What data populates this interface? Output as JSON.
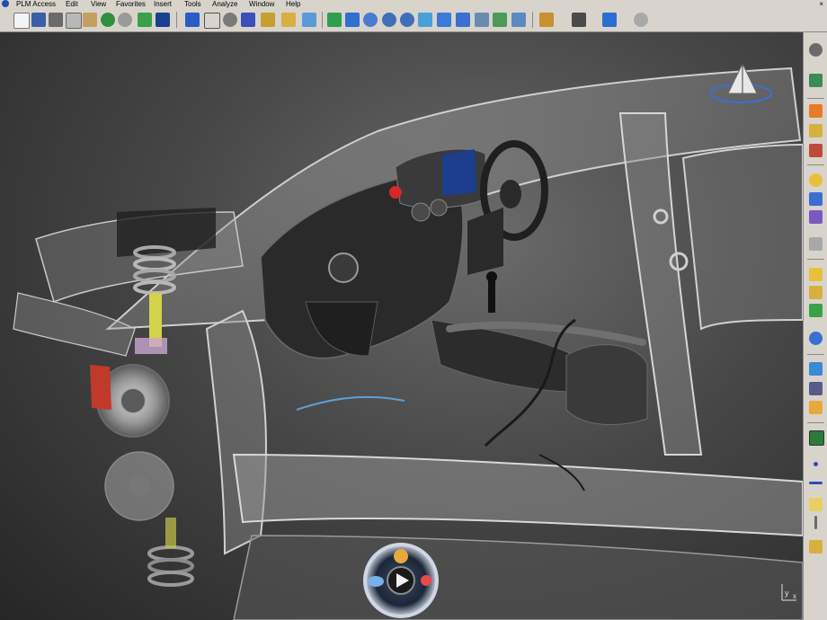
{
  "menubar": {
    "items": [
      "PLM Access",
      "Edit",
      "View",
      "Favorites",
      "Insert",
      "Tools",
      "Analyze",
      "Window",
      "Help"
    ],
    "close_glyph": "×"
  },
  "toolbar": {
    "icons": [
      "new-file-icon",
      "save-icon",
      "print-icon",
      "cut-icon",
      "copy-icon",
      "paste-icon",
      "undo-icon",
      "redo-icon",
      "update-icon",
      "whats-this-icon",
      "select-arrow-icon",
      "formula-icon",
      "catalog-icon",
      "table-icon",
      "sketch-icon",
      "body-icon",
      "hole-icon",
      "fit-all-icon",
      "pan-icon",
      "rotate-icon",
      "zoom-in-icon",
      "zoom-out-icon",
      "normal-view-icon",
      "multi-view-icon",
      "iso-view-icon",
      "shading-icon",
      "render-icon",
      "hide-show-icon",
      "capture-icon",
      "video-icon",
      "swap-icon",
      "undo-history-icon"
    ]
  },
  "right_toolbar": {
    "icons": [
      "sketcher-icon",
      "constraint-icon",
      "pointer-icon",
      "part-body-icon",
      "tree-icon",
      "material-icon",
      "measure-icon",
      "analysis-icon",
      "filter-icon",
      "assembly-icon",
      "product-icon",
      "component-icon",
      "move-icon",
      "snap-icon",
      "clash-icon",
      "explode-icon",
      "plane-icon",
      "point-icon",
      "line-icon",
      "surface-icon",
      "axis-icon",
      "law-icon"
    ]
  },
  "viewport": {
    "axis_labels": {
      "x": "x",
      "y": "y"
    },
    "compass": "compass-icon",
    "navigator": [
      "collaboration-icon",
      "play-icon",
      "network-icon",
      "cloud-icon"
    ]
  },
  "colors": {
    "ui_gray": "#d8d4cc",
    "viewport_dark": "#262626",
    "viewport_light": "#6b6b6b",
    "brake_red": "#c0392b",
    "spring_gray": "#a8a8a8",
    "strut_yellow": "#d4d24a",
    "gauge_blue": "#1c3e8c",
    "navigator_ring": "#cfd6e4"
  }
}
